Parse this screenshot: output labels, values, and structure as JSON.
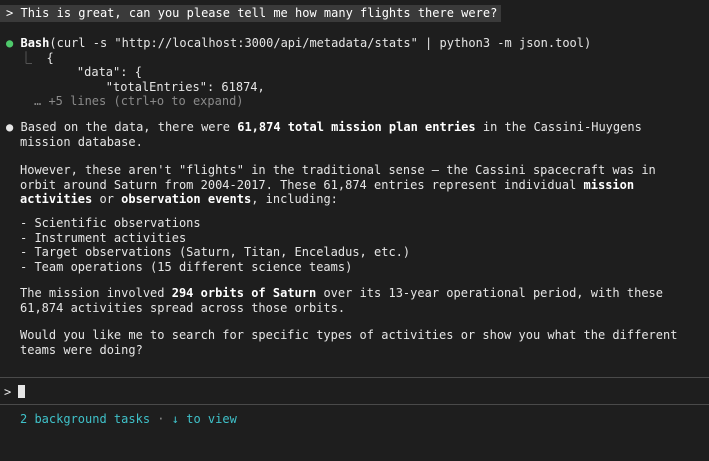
{
  "user_prompt": {
    "marker": ">",
    "text": "This is great, can you please tell me how many flights there were?"
  },
  "tool_call": {
    "bullet": "●",
    "name": "Bash",
    "args": "(curl -s \"http://localhost:3000/api/metadata/stats\" | python3 -m json.tool)",
    "output_prefix": "⎿",
    "output_lines": [
      "{",
      "    \"data\": {",
      "        \"totalEntries\": 61874,"
    ],
    "collapsed_note": "… +5 lines (ctrl+o to expand)"
  },
  "response": {
    "bullet": "●",
    "p1_a": "Based on the data, there were ",
    "p1_b": "61,874 total mission plan entries",
    "p1_c": " in the Cassini-Huygens",
    "p1_line2": "mission database.",
    "p2_line1": "However, these aren't \"flights\" in the traditional sense – the Cassini spacecraft was in",
    "p2_line2_a": "orbit around Saturn from 2004-2017. These 61,874 entries represent individual ",
    "p2_line2_b": "mission",
    "p2_line3_a": "activities",
    "p2_line3_b": " or ",
    "p2_line3_c": "observation events",
    "p2_line3_d": ", including:",
    "list": [
      "- Scientific observations",
      "- Instrument activities",
      "- Target observations (Saturn, Titan, Enceladus, etc.)",
      "- Team operations (15 different science teams)"
    ],
    "p3_line1_a": "The mission involved ",
    "p3_line1_b": "294 orbits of Saturn",
    "p3_line1_c": " over its 13-year operational period, with these",
    "p3_line2": "61,874 activities spread across those orbits.",
    "p4_line1": "Would you like me to search for specific types of activities or show you what the different",
    "p4_line2": "teams were doing?"
  },
  "input": {
    "marker": ">",
    "value": ""
  },
  "status": {
    "tasks": "2 background tasks",
    "separator": "·",
    "arrow": "↓",
    "hint": "to view"
  },
  "colors": {
    "background": "#1e1e1e",
    "tool_bullet": "#4ec96b",
    "status_text": "#3fc1c9"
  }
}
